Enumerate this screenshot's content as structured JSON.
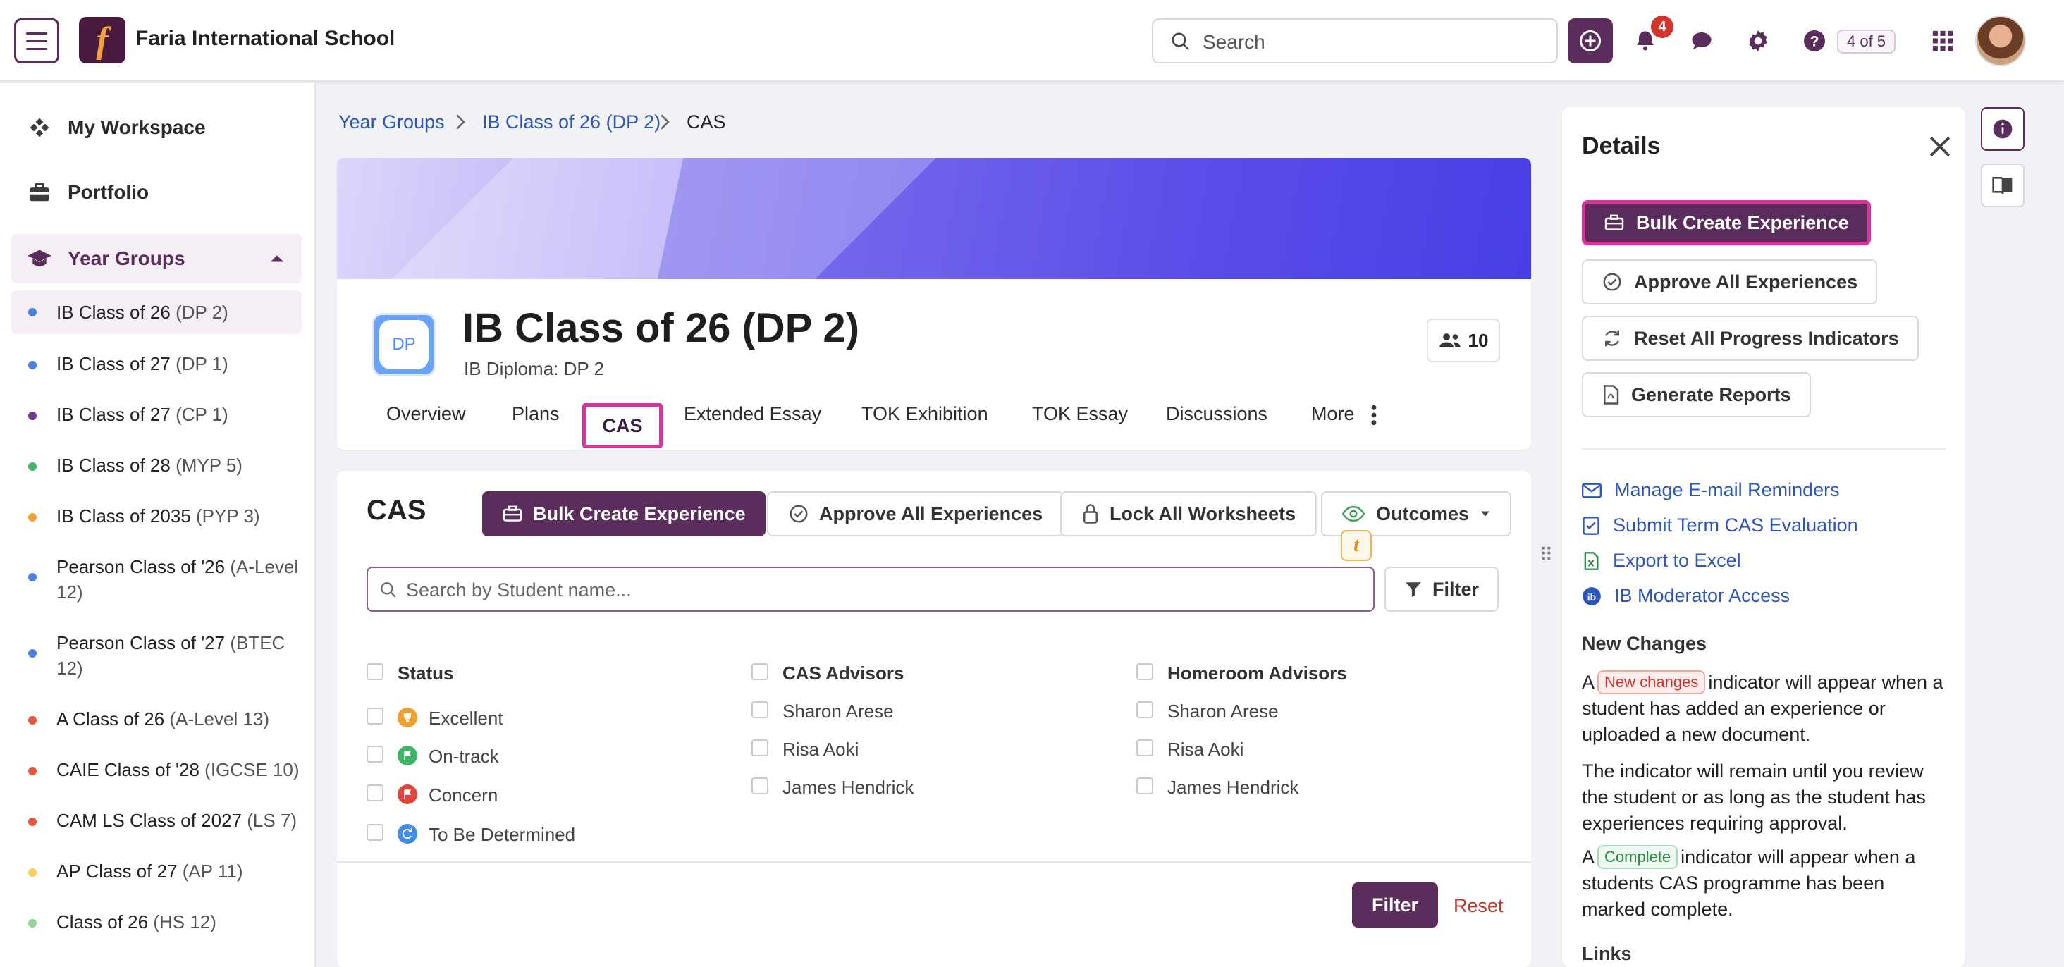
{
  "app": {
    "school_name": "Faria International School",
    "search_label": "Search",
    "notification_count": "4",
    "page_count": "4 of 5"
  },
  "sidebar": {
    "workspace": "My Workspace",
    "portfolio": "Portfolio",
    "year_groups": "Year Groups",
    "classes": [
      {
        "name": "IB Class of 26",
        "sub": "(DP 2)",
        "color": "#4a7fe0"
      },
      {
        "name": "IB Class of 27",
        "sub": "(DP 1)",
        "color": "#4a7fe0"
      },
      {
        "name": "IB Class of 27",
        "sub": "(CP 1)",
        "color": "#6b3a8e"
      },
      {
        "name": "IB Class of 28",
        "sub": "(MYP 5)",
        "color": "#43b36b"
      },
      {
        "name": "IB Class of 2035",
        "sub": "(PYP 3)",
        "color": "#f0a030"
      },
      {
        "name": "Pearson Class of '26",
        "sub": "(A-Level 12)",
        "color": "#4a7fe0"
      },
      {
        "name": "Pearson Class of '27",
        "sub": "(BTEC 12)",
        "color": "#4a7fe0"
      },
      {
        "name": "A Class of 26",
        "sub": "(A-Level 13)",
        "color": "#e6563f"
      },
      {
        "name": "CAIE Class of '28",
        "sub": "(IGCSE 10)",
        "color": "#e6563f"
      },
      {
        "name": "CAM LS Class of 2027",
        "sub": "(LS 7)",
        "color": "#e6563f"
      },
      {
        "name": "AP Class of 27",
        "sub": "(AP 11)",
        "color": "#f5d060"
      },
      {
        "name": "Class of 26",
        "sub": "(HS 12)",
        "color": "#8fd39a"
      }
    ]
  },
  "breadcrumb": [
    "Year Groups",
    "IB Class of 26 (DP 2)",
    "CAS"
  ],
  "header": {
    "logo_text": "DP",
    "title": "IB Class of 26 (DP 2)",
    "subtitle": "IB Diploma: DP 2",
    "member_count": "10",
    "tabs": [
      "Overview",
      "Plans",
      "CAS",
      "Extended Essay",
      "TOK Exhibition",
      "TOK Essay",
      "Discussions",
      "More"
    ]
  },
  "cas": {
    "title": "CAS",
    "bulk_create": "Bulk Create Experience",
    "approve_all": "Approve All Experiences",
    "lock_all": "Lock All Worksheets",
    "outcomes": "Outcomes",
    "search_placeholder": "Search by Student name...",
    "filter": "Filter",
    "status_header": "Status",
    "status_items": [
      "Excellent",
      "On-track",
      "Concern",
      "To Be Determined"
    ],
    "cas_advisors_header": "CAS Advisors",
    "homeroom_header": "Homeroom Advisors",
    "advisors": [
      "Sharon Arese",
      "Risa Aoki",
      "James Hendrick"
    ],
    "filter_button": "Filter",
    "reset": "Reset"
  },
  "details": {
    "title": "Details",
    "bulk_create": "Bulk Create Experience",
    "approve_all": "Approve All Experiences",
    "reset_progress": "Reset All Progress Indicators",
    "generate_reports": "Generate Reports",
    "links": [
      "Manage E-mail Reminders",
      "Submit Term CAS Evaluation",
      "Export to Excel",
      "IB Moderator Access"
    ],
    "new_changes_heading": "New Changes",
    "p1_a": "A",
    "p1_pill": "New changes",
    "p1_b": "indicator will appear when a student has added an experience or uploaded a new document.",
    "p2": "The indicator will remain until you review the student or as long as the student has experiences requiring approval.",
    "p3_a": "A",
    "p3_pill": "Complete",
    "p3_b": "indicator will appear when a students CAS programme has been marked complete.",
    "links_heading": "Links"
  }
}
